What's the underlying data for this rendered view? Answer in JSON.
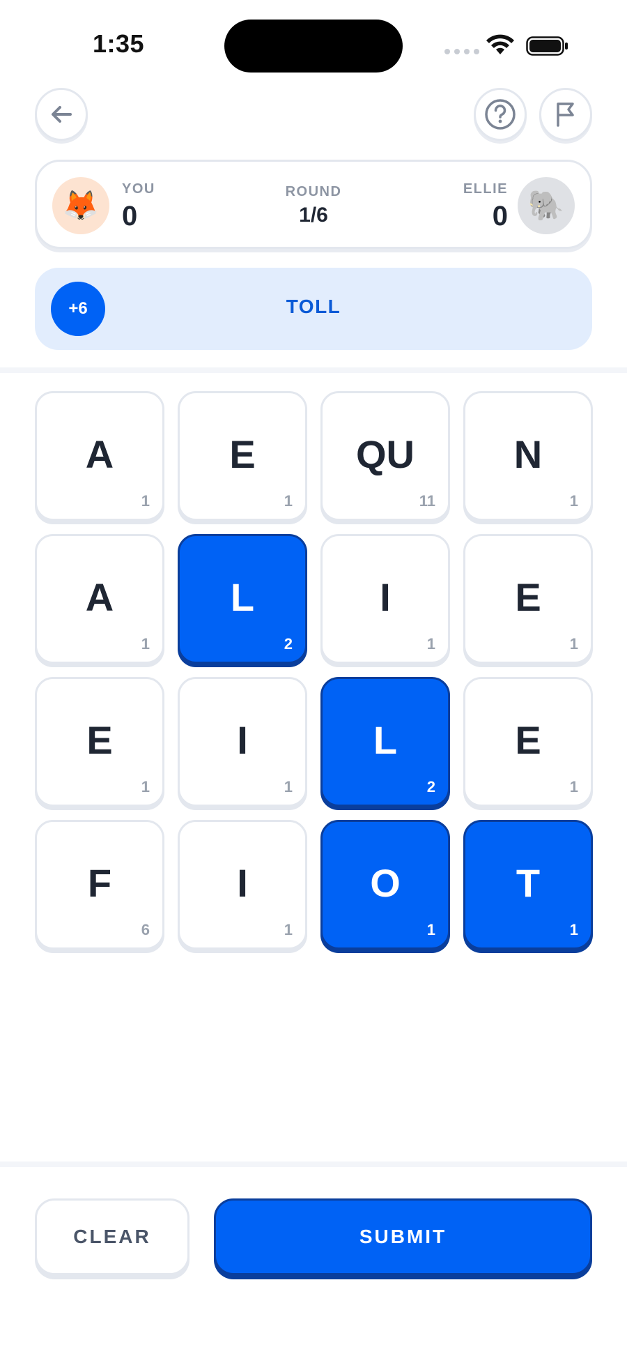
{
  "status_bar": {
    "time": "1:35"
  },
  "header": {
    "back_icon": "arrow-left-icon",
    "help_icon": "question-circle-icon",
    "flag_icon": "flag-icon"
  },
  "score": {
    "you": {
      "label": "YOU",
      "score": "0",
      "avatar": "🦊"
    },
    "round": {
      "label": "ROUND",
      "value": "1/6"
    },
    "opponent": {
      "label": "ELLIE",
      "score": "0",
      "avatar": "🐘"
    }
  },
  "current_word": {
    "points": "+6",
    "word": "TOLL"
  },
  "board": {
    "tiles": [
      {
        "letter": "A",
        "points": "1",
        "selected": false
      },
      {
        "letter": "E",
        "points": "1",
        "selected": false
      },
      {
        "letter": "QU",
        "points": "11",
        "selected": false
      },
      {
        "letter": "N",
        "points": "1",
        "selected": false
      },
      {
        "letter": "A",
        "points": "1",
        "selected": false
      },
      {
        "letter": "L",
        "points": "2",
        "selected": true
      },
      {
        "letter": "I",
        "points": "1",
        "selected": false
      },
      {
        "letter": "E",
        "points": "1",
        "selected": false
      },
      {
        "letter": "E",
        "points": "1",
        "selected": false
      },
      {
        "letter": "I",
        "points": "1",
        "selected": false
      },
      {
        "letter": "L",
        "points": "2",
        "selected": true
      },
      {
        "letter": "E",
        "points": "1",
        "selected": false
      },
      {
        "letter": "F",
        "points": "6",
        "selected": false
      },
      {
        "letter": "I",
        "points": "1",
        "selected": false
      },
      {
        "letter": "O",
        "points": "1",
        "selected": true
      },
      {
        "letter": "T",
        "points": "1",
        "selected": true
      }
    ]
  },
  "actions": {
    "clear_label": "CLEAR",
    "submit_label": "SUBMIT"
  },
  "colors": {
    "accent": "#0062f5",
    "accent_dark": "#0a3e9c",
    "banner_bg": "#e2edfd",
    "muted_text": "#8d95a3"
  }
}
